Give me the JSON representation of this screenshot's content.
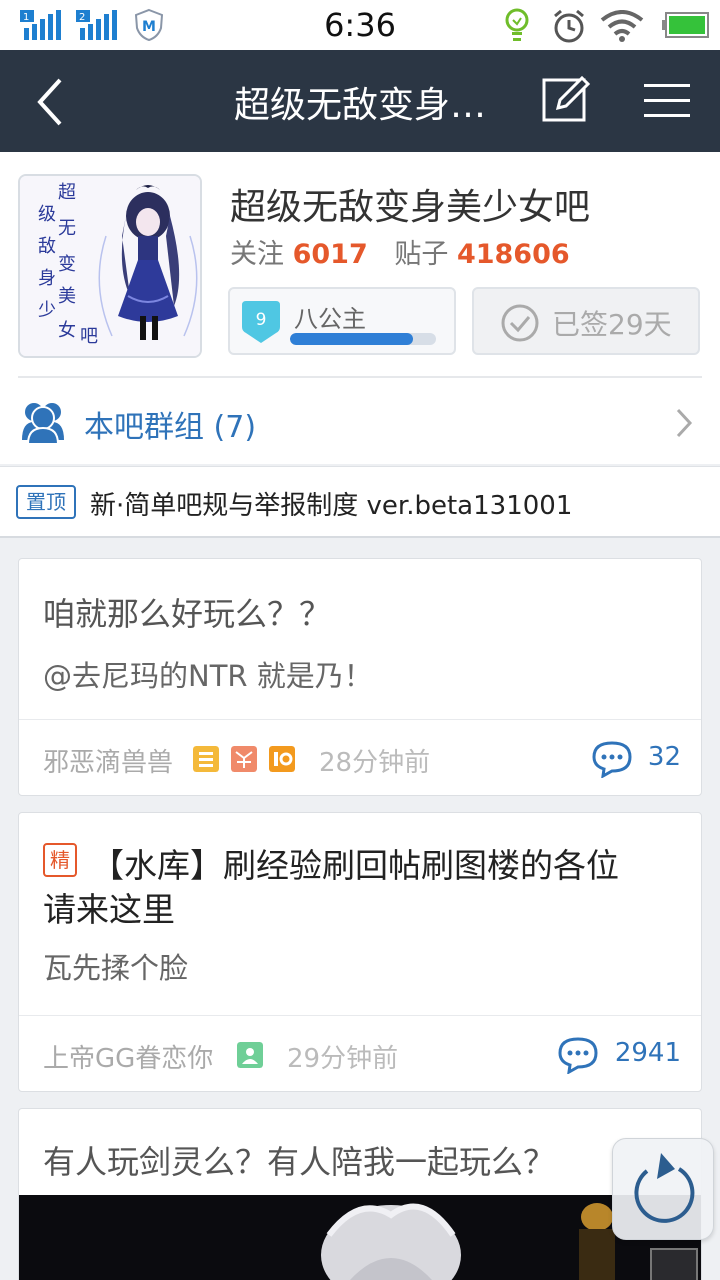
{
  "status_bar": {
    "time": "6:36",
    "sim1_label": "1",
    "sim2_label": "2",
    "icons": [
      "signal-icon",
      "signal-icon",
      "security-shield-icon",
      "bulb-icon",
      "alarm-icon",
      "wifi-icon",
      "battery-icon"
    ],
    "battery_color": "#35c23a"
  },
  "nav": {
    "title": "超级无敌变身…",
    "icons": [
      "back-arrow-icon",
      "compose-icon",
      "menu-icon"
    ]
  },
  "forum": {
    "name": "超级无敌变身美少女吧",
    "avatar_text_lines": [
      "超",
      "级",
      "无",
      "敌",
      "变",
      "身",
      "美",
      "少",
      "女",
      "吧"
    ],
    "follow_label": "关注",
    "follow_count": "6017",
    "posts_label": "贴子",
    "posts_count": "418606",
    "level_number": "9",
    "level_name": "八公主",
    "level_progress": 0.84,
    "sign_label": "已签29天",
    "group_label": "本吧群组 (7)"
  },
  "pinned": {
    "badge": "置顶",
    "text": "新·简单吧规与举报制度 ver.beta131001"
  },
  "posts": [
    {
      "title": "咱就那么好玩么？？",
      "excerpt": "@去尼玛的NTR 就是乃！",
      "author": "邪恶滴兽兽",
      "time": "28分钟前",
      "replies": "32"
    },
    {
      "badge": "精",
      "title_line1": "【水库】刷经验刷回帖刷图楼的各位",
      "title_line2": "请来这里",
      "excerpt": "瓦先揉个脸",
      "author": "上帝GG眷恋你",
      "time": "29分钟前",
      "replies": "2941"
    },
    {
      "title": "有人玩剑灵么？有人陪我一起玩么？"
    }
  ],
  "colors": {
    "navbar": "#2b3644",
    "accent_blue": "#2f73b9",
    "accent_orange": "#e5582b"
  }
}
